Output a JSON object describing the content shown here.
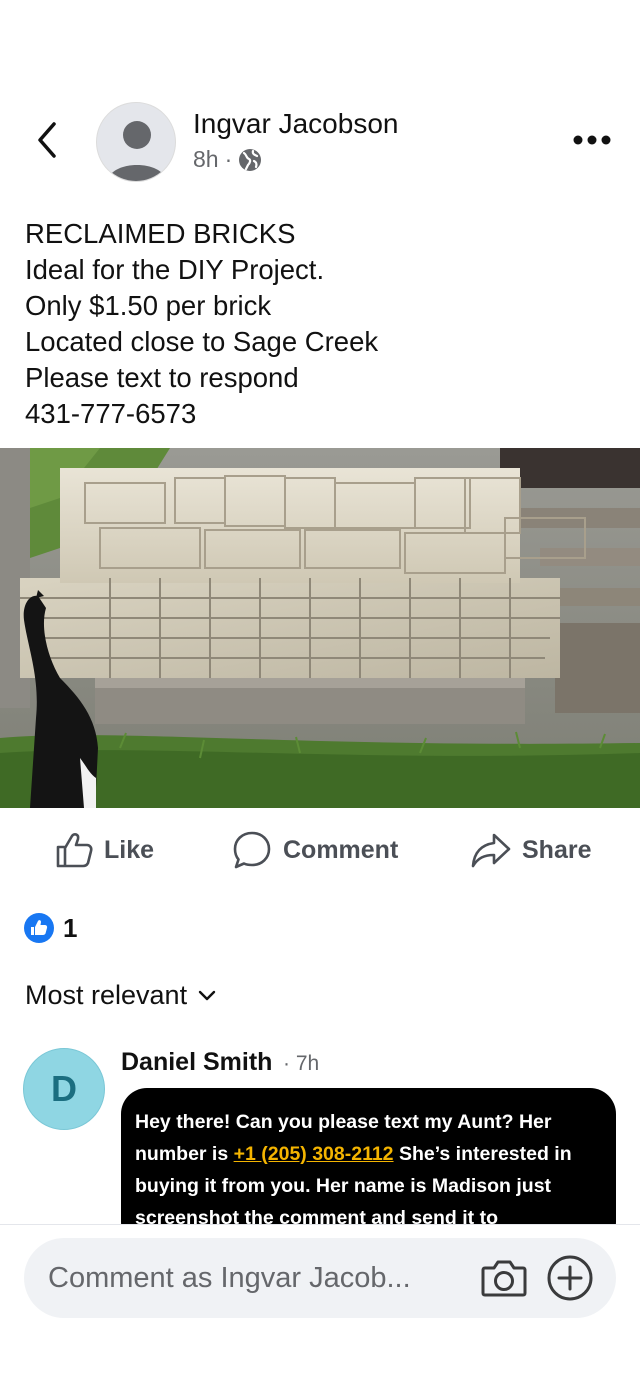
{
  "post": {
    "author": "Ingvar Jacobson",
    "time": "8h",
    "separator": "·",
    "lines": [
      "RECLAIMED BRICKS",
      "Ideal for the DIY Project.",
      "Only $1.50 per brick",
      "Located close to Sage Creek",
      "Please text to respond",
      "431-777-6573"
    ]
  },
  "actions": {
    "like": "Like",
    "comment": "Comment",
    "share": "Share"
  },
  "reactions": {
    "count": "1"
  },
  "sort": {
    "label": "Most relevant"
  },
  "comment": {
    "initial": "D",
    "author": "Daniel Smith",
    "time": "· 7h",
    "text_before": "Hey there! Can you please text my Aunt? Her number is ",
    "phone": "+1 (205) 308-2112",
    "text_after": " She’s interested in buying it from you. Her name is Madison just screenshot the comment and send it to"
  },
  "composer": {
    "placeholder": "Comment as Ingvar Jacob..."
  },
  "colors": {
    "like_blue": "#1877f2",
    "phone_link": "#f4b400",
    "avatar_teal": "#8fd6e3"
  }
}
